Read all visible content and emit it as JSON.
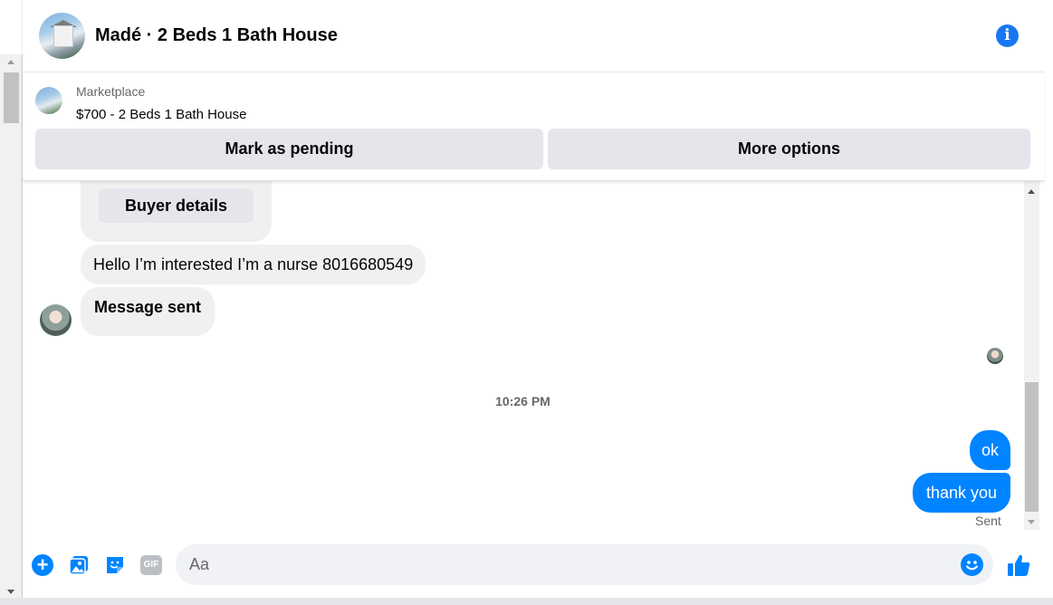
{
  "header": {
    "title": "Madé · 2 Beds 1 Bath House",
    "avatar_icon": "house-photo",
    "info_icon": "info-icon",
    "info_glyph": "i"
  },
  "marketplace": {
    "label": "Marketplace",
    "listing": "$700 - 2 Beds 1 Bath House",
    "mark_pending_label": "Mark as pending",
    "more_options_label": "More options"
  },
  "messages": {
    "buyer_details_label": "Buyer details",
    "incoming": [
      {
        "text": "Hello I’m interested I’m a nurse 8016680549"
      },
      {
        "text": "Message sent"
      }
    ],
    "timestamp": "10:26 PM",
    "outgoing": [
      {
        "text": "ok"
      },
      {
        "text": "thank you"
      }
    ],
    "status": "Sent"
  },
  "composer": {
    "placeholder": "Aa",
    "plus_glyph": "+",
    "gif_label": "GIF"
  },
  "colors": {
    "accent": "#0084ff",
    "brand_blue": "#1877f2",
    "button_gray": "#e4e6eb",
    "bubble_gray": "#f0f0f0"
  }
}
